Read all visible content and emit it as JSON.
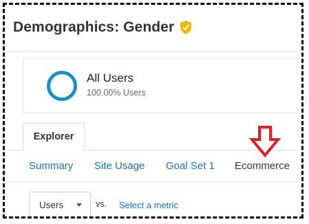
{
  "page": {
    "title": "Demographics: Gender"
  },
  "segment": {
    "name": "All Users",
    "subtitle": "100.00% Users"
  },
  "tabs": [
    {
      "label": "Explorer",
      "active": true
    }
  ],
  "subnav": [
    {
      "label": "Summary"
    },
    {
      "label": "Site Usage"
    },
    {
      "label": "Goal Set 1"
    },
    {
      "label": "Ecommerce"
    }
  ],
  "controls": {
    "primary_metric": "Users",
    "vs_label": "vs.",
    "secondary_metric_link": "Select a metric"
  },
  "colors": {
    "link": "#1a73b8",
    "ring": "#1a8fc9",
    "verified_badge": "#f4b400",
    "arrow_annotation": "#e02020"
  },
  "icons": {
    "title_badge": "verified-check-icon",
    "segment": "segment-ring-icon",
    "annotation": "down-arrow-icon",
    "dropdown": "caret-down-icon"
  }
}
